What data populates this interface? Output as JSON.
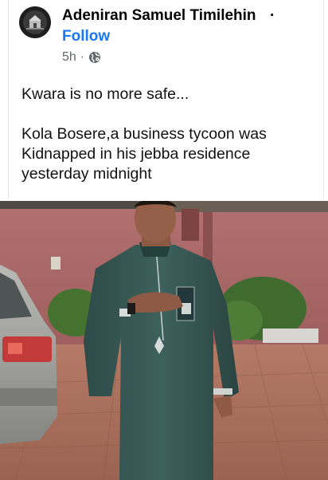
{
  "post": {
    "author": "Adeniran Samuel Timilehin",
    "separator": "·",
    "follow_label": "Follow",
    "time": "5h",
    "meta_sep": "·",
    "audience_icon": "globe-icon",
    "text_line1": "Kwara is no more safe...",
    "text_line2": "Kola Bosere,a business tycoon was Kidnapped in his jebba residence yesterday midnight"
  },
  "colors": {
    "follow": "#1877f2",
    "meta": "#65676b"
  }
}
